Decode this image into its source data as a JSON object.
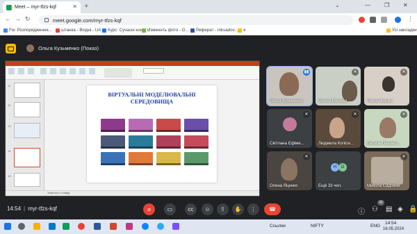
{
  "browser": {
    "tab_title": "Meet – myr-tfzs-kqf",
    "new_tab": "+",
    "url": "meet.google.com/myr-tfzs-kqf",
    "bookmarks": [
      "Fw: Розпорядження...",
      "штанка - Вхідні - UA",
      "Курс: Сучасні конст...",
      "Изменить фото - G...",
      "Реферат - mksadov...",
      "я"
    ],
    "all_bookmarks": "Усі закладки",
    "colors": {
      "tabstrip": "#dfe3e8",
      "bookmark_icons": [
        "#4285f4",
        "#e94235",
        "#1a73e8",
        "#7cb342",
        "#2b579a",
        "#fbbc04"
      ]
    }
  },
  "meet": {
    "presenter": "Ольга Кузьменко (Показ)",
    "meeting_time": "14:54",
    "meeting_code": "myr-tfzs-kqf",
    "separator": "|",
    "people_count": "42",
    "colors": {
      "background": "#202124",
      "end_call": "#ea4335",
      "mic_off": "#ea4335",
      "speaking": "#1a73e8"
    },
    "controls": [
      "mic-off-icon",
      "camera-icon",
      "captions-icon",
      "emoji-icon",
      "present-icon",
      "raise-hand-icon",
      "more-icon",
      "end-call-icon"
    ],
    "right_controls": [
      "info-icon",
      "people-icon",
      "chat-icon",
      "activities-icon",
      "lock-icon"
    ]
  },
  "participants": [
    {
      "name": "Ольга Кузьменко",
      "mic": "speaking"
    },
    {
      "name": "Олена Михайл...",
      "mic": "muted"
    },
    {
      "name": "Роман Кушка",
      "mic": "muted"
    },
    {
      "name": "Світлана Єфіме...",
      "mic": "muted"
    },
    {
      "name": "Людмила Колісн...",
      "mic": "muted"
    },
    {
      "name": "Василь Пашкес...",
      "mic": "muted"
    },
    {
      "name": "Олена Яценко",
      "mic": "muted"
    },
    {
      "name": "Ещё 33 чел.",
      "initials": [
        "Н",
        "О"
      ]
    },
    {
      "name": "Микола Садовий",
      "mic": "muted"
    }
  ],
  "shared_screen": {
    "slide_title_line1": "ВІРТУАЛЬНІ МОДЕЛЮВАЛЬНІ",
    "slide_title_line2": "СЕРЕДОВИЩА",
    "slide_title_color": "#1f3e9e",
    "status_text": "Заметки к слайду",
    "slide_numbers": [
      "11",
      "12",
      "13",
      "14",
      "15"
    ]
  },
  "taskbar": {
    "weather": "Ссылки",
    "ticker": "NIFTY",
    "lang": "ENG",
    "time": "14:54",
    "date": "16.05.2024"
  }
}
